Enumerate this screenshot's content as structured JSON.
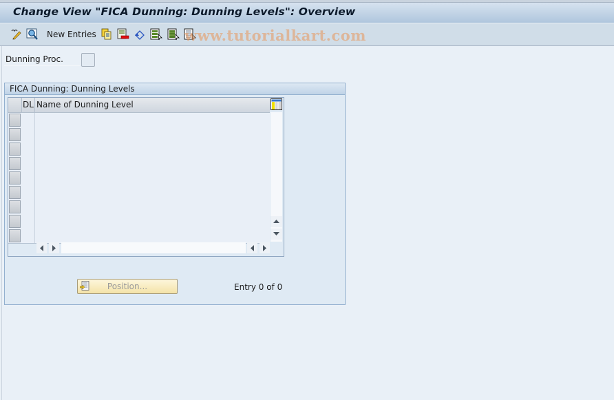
{
  "window": {
    "title": "Change View \"FICA Dunning: Dunning Levels\": Overview"
  },
  "toolbar": {
    "items": [
      {
        "icon": "display-change-icon",
        "tooltip": ""
      },
      {
        "icon": "find-icon",
        "tooltip": ""
      },
      {
        "label": "New Entries"
      },
      {
        "icon": "copy-as-icon"
      },
      {
        "icon": "delete-icon"
      },
      {
        "icon": "undo-change-icon"
      },
      {
        "icon": "select-all-icon"
      },
      {
        "icon": "select-block-icon"
      },
      {
        "icon": "deselect-all-icon"
      }
    ],
    "new_entries_label": "New Entries"
  },
  "watermark": "www.tutorialkart.com",
  "fields": {
    "dunning_proc": {
      "label": "Dunning Proc.",
      "value": ""
    }
  },
  "groupbox": {
    "title": "FICA Dunning: Dunning Levels",
    "table": {
      "columns": [
        "DL",
        "Name of Dunning Level"
      ],
      "rows": [
        [
          "",
          ""
        ],
        [
          "",
          ""
        ],
        [
          "",
          ""
        ],
        [
          "",
          ""
        ],
        [
          "",
          ""
        ],
        [
          "",
          ""
        ],
        [
          "",
          ""
        ],
        [
          "",
          ""
        ],
        [
          "",
          ""
        ]
      ]
    },
    "position_button": "Position...",
    "entry_count": "Entry 0 of 0"
  },
  "colors": {
    "title_gradient_top": "#d6e2ef",
    "title_gradient_bottom": "#afc6dd",
    "toolbar_bg": "#d0dde8",
    "page_bg": "#e9f0f7",
    "groupbox_bg": "#dfeaf4",
    "position_button_bg": "#f4e3a8"
  }
}
